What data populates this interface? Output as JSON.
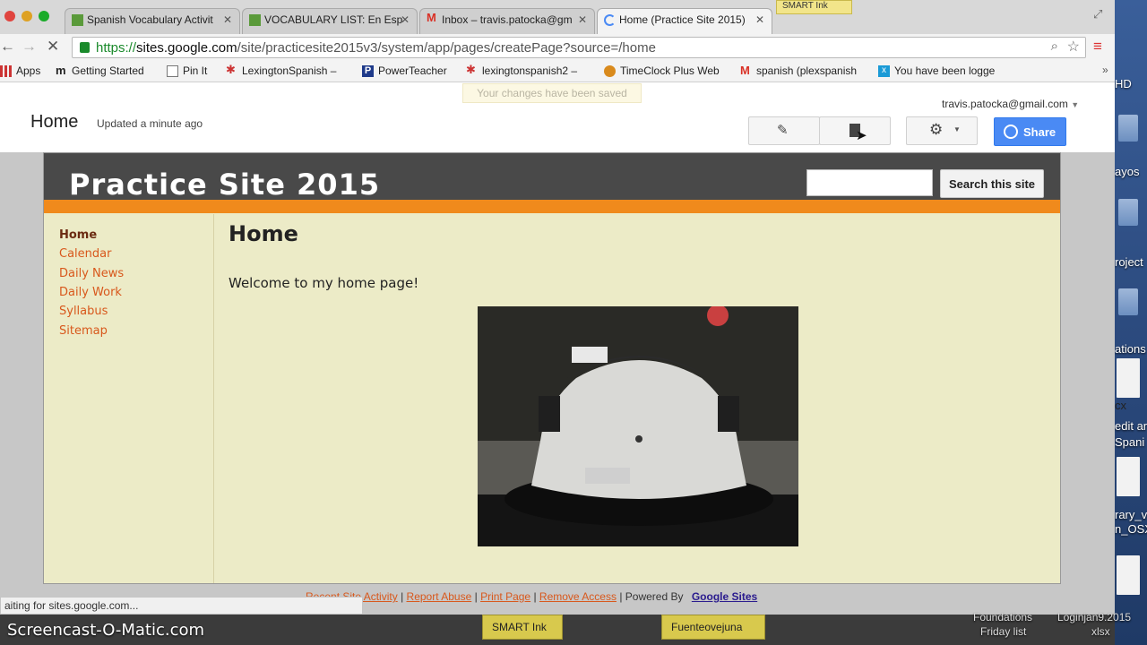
{
  "browser": {
    "tabs": [
      {
        "label": "Spanish Vocabulary Activit",
        "active": false
      },
      {
        "label": "VOCABULARY LIST: En Esp",
        "active": false
      },
      {
        "label": "Inbox – travis.patocka@gm",
        "active": false
      },
      {
        "label": "Home (Practice Site 2015)",
        "active": true
      }
    ],
    "url_https": "https://",
    "url_host": "sites.google.com",
    "url_path": "/site/practicesite2015v3/system/app/pages/createPage?source=/home",
    "smart_ink_label": "SMART Ink",
    "bookmarks": [
      "Apps",
      "Getting Started",
      "Pin It",
      "LexingtonSpanish –",
      "PowerTeacher",
      "lexingtonspanish2 –",
      "TimeClock Plus Web",
      "spanish (plexspanish",
      "You have been logge"
    ],
    "status": "aiting for sites.google.com..."
  },
  "sites_header": {
    "toast": "Your changes have been saved",
    "title": "Home",
    "updated": "Updated a minute ago",
    "user": "travis.patocka@gmail.com",
    "share": "Share"
  },
  "site": {
    "title": "Practice Site 2015",
    "search_button": "Search this site",
    "nav": [
      "Home",
      "Calendar",
      "Daily News",
      "Daily Work",
      "Syllabus",
      "Sitemap"
    ],
    "heading": "Home",
    "welcome": "Welcome to my home page!",
    "footer": {
      "recent": "Recent Site Activity",
      "abuse": "Report Abuse",
      "print": "Print Page",
      "remove": "Remove Access",
      "powered": "Powered By",
      "gs": "Google Sites",
      "sep": "|"
    }
  },
  "desktop": {
    "labels": [
      "HD",
      "ayos",
      "roject",
      "ations",
      "cx",
      "edit ar",
      "Spani",
      "rary_v",
      "n_OSX",
      "Foundations",
      "Friday list",
      "Loginjan9.2015",
      "xlsx"
    ],
    "dock_items": [
      "SMART Ink",
      "Fuenteovejuna"
    ],
    "watermark": "Screencast-O-Matic.com"
  }
}
